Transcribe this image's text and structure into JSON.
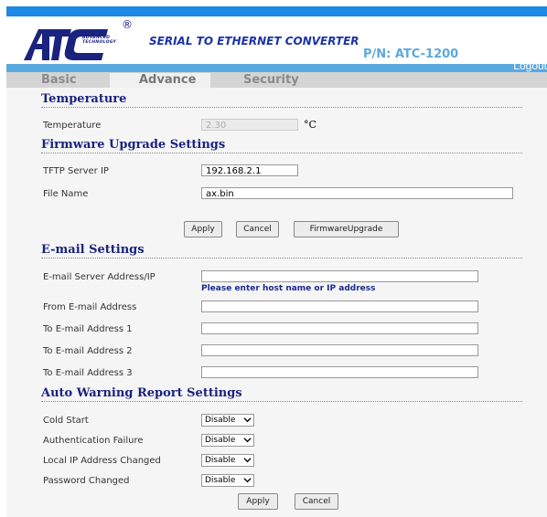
{
  "header": {
    "logo_text": "ATC",
    "logo_subtitle": "ADVANCED TECHNOLOGY",
    "registered_mark": "®",
    "product_title": "SERIAL TO ETHERNET CONVERTER",
    "part_number": "P/N: ATC-1200",
    "logout_label": "Logout"
  },
  "tabs": [
    {
      "label": "Basic",
      "active": false
    },
    {
      "label": "Advance",
      "active": true
    },
    {
      "label": "Security",
      "active": false
    }
  ],
  "temperature": {
    "section_title": "Temperature",
    "label": "Temperature",
    "value": "2.30",
    "unit": "°C"
  },
  "firmware": {
    "section_title": "Firmware Upgrade Settings",
    "tftp_label": "TFTP Server IP",
    "tftp_value": "192.168.2.1",
    "file_label": "File Name",
    "file_value": "ax.bin",
    "apply_label": "Apply",
    "cancel_label": "Cancel",
    "upgrade_label": "FirmwareUpgrade"
  },
  "email": {
    "section_title": "E-mail Settings",
    "server_label": "E-mail Server Address/IP",
    "server_value": "",
    "server_hint": "Please enter host name or IP address",
    "from_label": "From E-mail Address",
    "from_value": "",
    "to1_label": "To E-mail Address 1",
    "to1_value": "",
    "to2_label": "To E-mail Address 2",
    "to2_value": "",
    "to3_label": "To E-mail Address 3",
    "to3_value": ""
  },
  "warning": {
    "section_title": "Auto Warning Report Settings",
    "cold_start_label": "Cold Start",
    "cold_start_value": "Disable",
    "auth_fail_label": "Authentication Failure",
    "auth_fail_value": "Disable",
    "ip_changed_label": "Local IP Address Changed",
    "ip_changed_value": "Disable",
    "pwd_changed_label": "Password Changed",
    "pwd_changed_value": "Disable",
    "apply_label": "Apply",
    "cancel_label": "Cancel"
  },
  "colors": {
    "topbar": "#1e88e5",
    "navbar": "#5aa9e0",
    "section_title": "#1a237e",
    "hint": "#1a2a8f"
  }
}
